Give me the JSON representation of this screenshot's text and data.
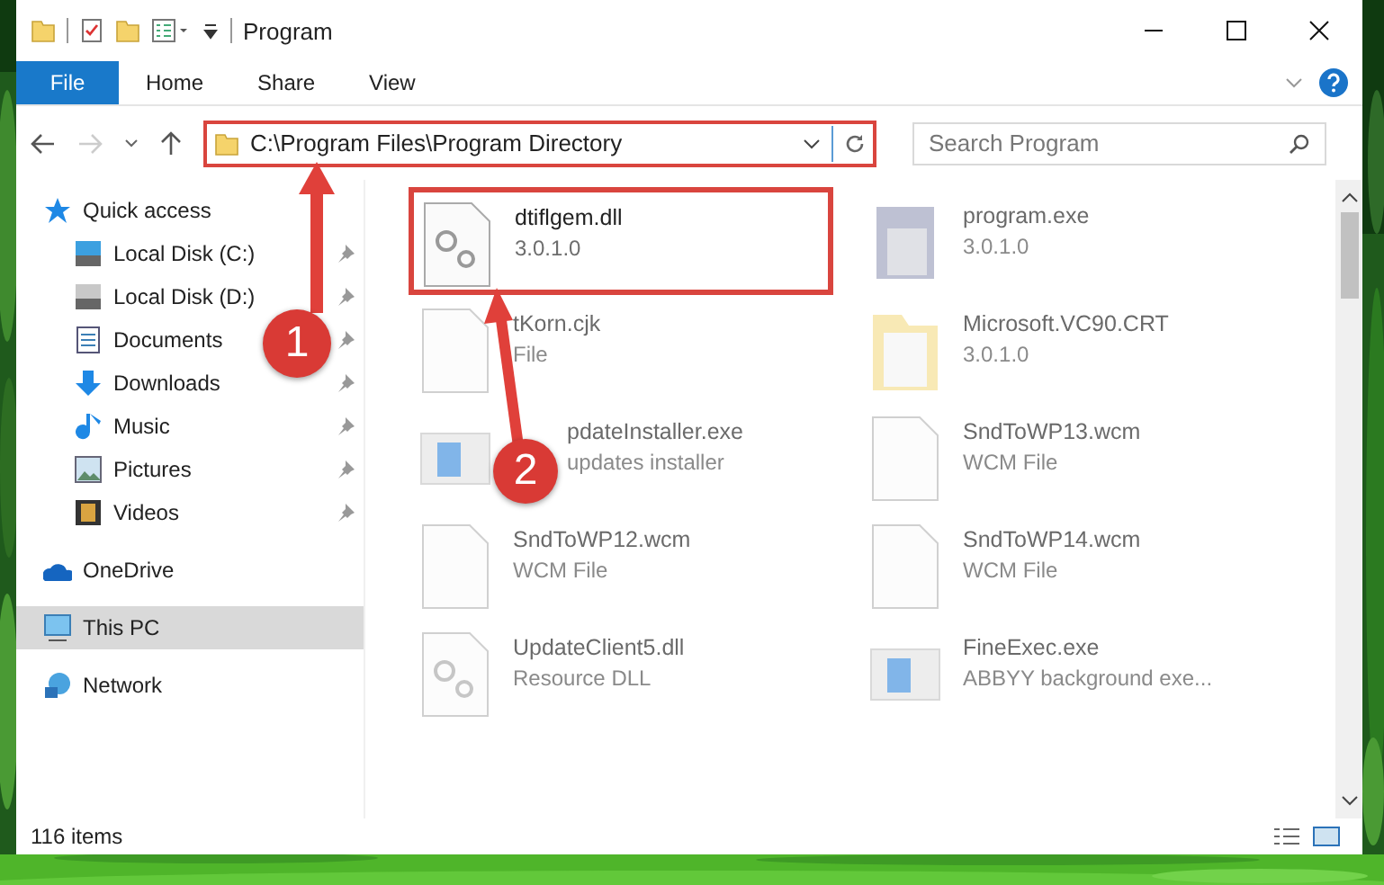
{
  "window": {
    "title": "Program"
  },
  "ribbon": {
    "tabs": [
      {
        "label": "File",
        "selected": true
      },
      {
        "label": "Home",
        "selected": false
      },
      {
        "label": "Share",
        "selected": false
      },
      {
        "label": "View",
        "selected": false
      }
    ]
  },
  "address_bar": {
    "path": "C:\\Program Files\\Program Directory",
    "highlighted": true
  },
  "search": {
    "placeholder": "Search Program"
  },
  "sidebar": {
    "items": [
      {
        "label": "Quick access",
        "kind": "star",
        "selected": false,
        "children": [
          {
            "label": "Local Disk (C:)",
            "kind": "drive-c",
            "pinned": true,
            "selected": false
          },
          {
            "label": "Local Disk (D:)",
            "kind": "drive",
            "pinned": true,
            "selected": false
          },
          {
            "label": "Documents",
            "kind": "documents",
            "pinned": true,
            "selected": false
          },
          {
            "label": "Downloads",
            "kind": "downloads",
            "pinned": true,
            "selected": false
          },
          {
            "label": "Music",
            "kind": "music",
            "pinned": true,
            "selected": false
          },
          {
            "label": "Pictures",
            "kind": "pictures",
            "pinned": true,
            "selected": false
          },
          {
            "label": "Videos",
            "kind": "videos",
            "pinned": true,
            "selected": false
          }
        ]
      },
      {
        "label": "OneDrive",
        "kind": "cloud",
        "selected": false
      },
      {
        "label": "This PC",
        "kind": "computer",
        "selected": true
      },
      {
        "label": "Network",
        "kind": "network",
        "selected": false
      }
    ]
  },
  "files": [
    {
      "name": "dtiflgem.dll",
      "detail": "3.0.1.0",
      "kind": "library",
      "blurred": false,
      "highlighted": true
    },
    {
      "name": "program.exe",
      "detail": "3.0.1.0",
      "kind": "program",
      "blurred": true,
      "highlighted": false
    },
    {
      "name": "tKorn.cjk",
      "detail": "File",
      "kind": "document",
      "blurred": true,
      "highlighted": false
    },
    {
      "name": "Microsoft.VC90.CRT",
      "detail": "3.0.1.0",
      "kind": "folder",
      "blurred": true,
      "highlighted": false
    },
    {
      "name": "pdateInstaller.exe",
      "detail": "updates installer",
      "kind": "installer",
      "blurred": true,
      "highlighted": false
    },
    {
      "name": "SndToWP13.wcm",
      "detail": "WCM File",
      "kind": "document",
      "blurred": true,
      "highlighted": false
    },
    {
      "name": "SndToWP12.wcm",
      "detail": "WCM File",
      "kind": "document",
      "blurred": true,
      "highlighted": false
    },
    {
      "name": "SndToWP14.wcm",
      "detail": "WCM File",
      "kind": "document",
      "blurred": true,
      "highlighted": false
    },
    {
      "name": "UpdateClient5.dll",
      "detail": "Resource DLL",
      "kind": "library",
      "blurred": true,
      "highlighted": false
    },
    {
      "name": "FineExec.exe",
      "detail": "ABBYY background exe...",
      "kind": "installer",
      "blurred": true,
      "highlighted": false
    }
  ],
  "status_bar": {
    "item_count": "116 items"
  },
  "annotations": [
    {
      "label": "1"
    },
    {
      "label": "2"
    }
  ]
}
